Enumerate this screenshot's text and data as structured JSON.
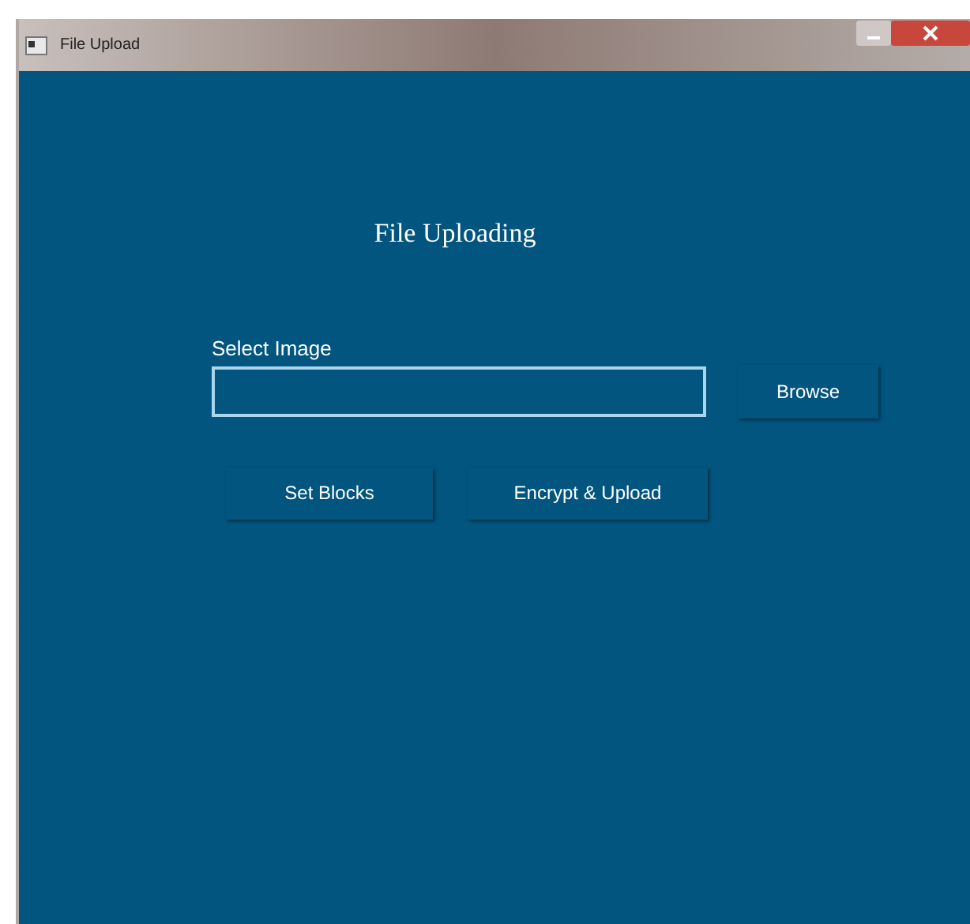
{
  "window": {
    "title": "File Upload"
  },
  "heading": "File Uploading",
  "image_field": {
    "label": "Select Image"
  },
  "buttons": [
    {
      "label": "Browse"
    },
    {
      "label": "Set Blocks"
    },
    {
      "label": "Encrypt & Upload"
    }
  ]
}
